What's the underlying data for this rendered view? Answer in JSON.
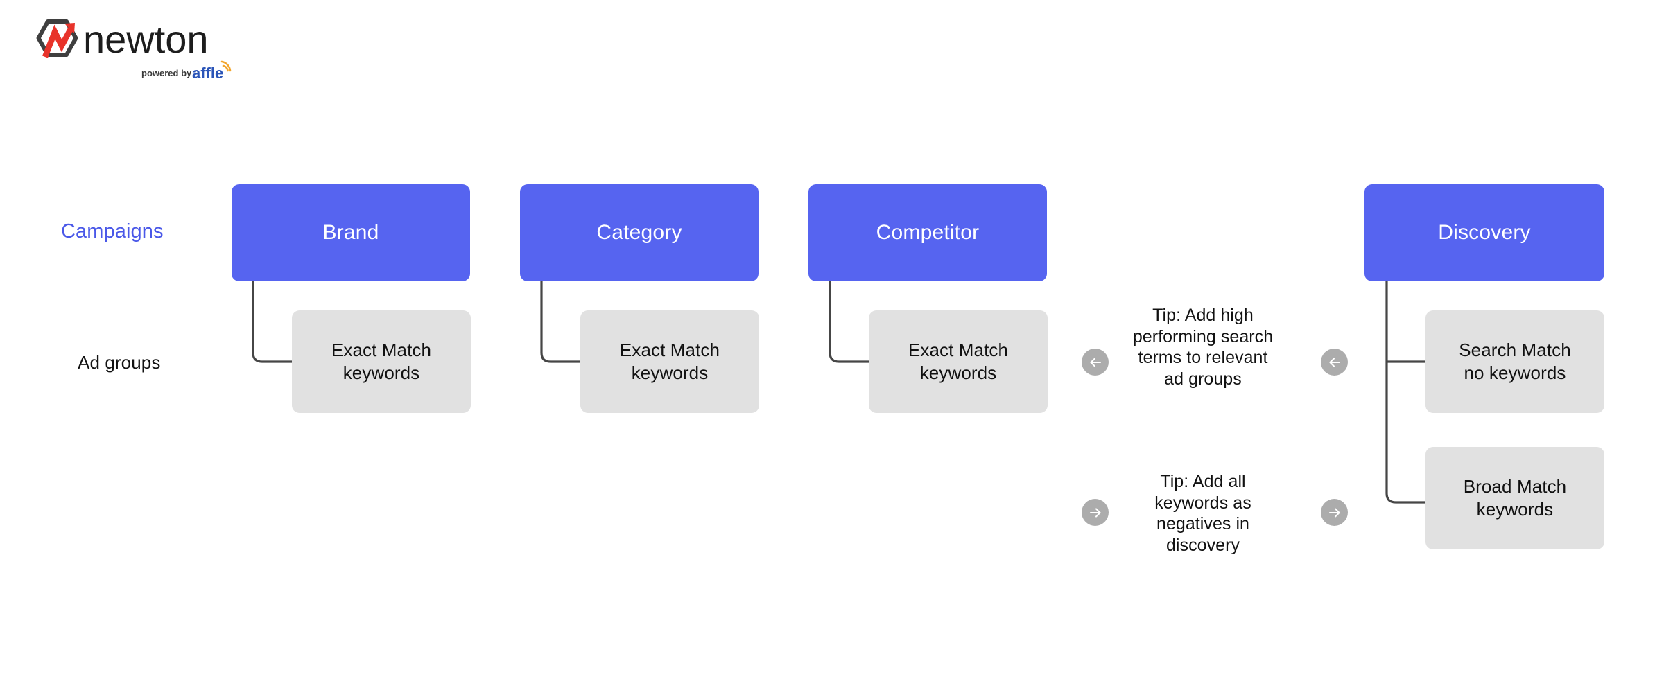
{
  "brand": {
    "logo_wordmark": "newton",
    "logo_tagline_prefix": "powered by",
    "logo_tagline_brand": "affle",
    "accent_blue": "#5664f0",
    "label_blue": "#4a58e8",
    "adgroup_gray": "#e1e1e1",
    "connector_gray": "#464646",
    "badge_gray": "#acacac"
  },
  "row_labels": {
    "campaigns": "Campaigns",
    "ad_groups": "Ad groups"
  },
  "campaigns": [
    {
      "id": "brand",
      "label": "Brand"
    },
    {
      "id": "category",
      "label": "Category"
    },
    {
      "id": "competitor",
      "label": "Competitor"
    },
    {
      "id": "discovery",
      "label": "Discovery"
    }
  ],
  "ad_groups": [
    {
      "id": "brand-exact",
      "line1": "Exact Match",
      "line2": "keywords",
      "parent": "brand"
    },
    {
      "id": "category-exact",
      "line1": "Exact Match",
      "line2": "keywords",
      "parent": "category"
    },
    {
      "id": "competitor-exact",
      "line1": "Exact Match",
      "line2": "keywords",
      "parent": "competitor"
    },
    {
      "id": "discovery-search",
      "line1": "Search Match",
      "line2": "no keywords",
      "parent": "discovery"
    },
    {
      "id": "discovery-broad",
      "line1": "Broad Match",
      "line2": "keywords",
      "parent": "discovery"
    }
  ],
  "tips": [
    {
      "id": "tip-search-terms",
      "direction": "left",
      "text": "Tip: Add high performing search terms to relevant ad groups"
    },
    {
      "id": "tip-negatives",
      "direction": "right",
      "text": "Tip: Add all keywords as negatives in discovery"
    }
  ]
}
